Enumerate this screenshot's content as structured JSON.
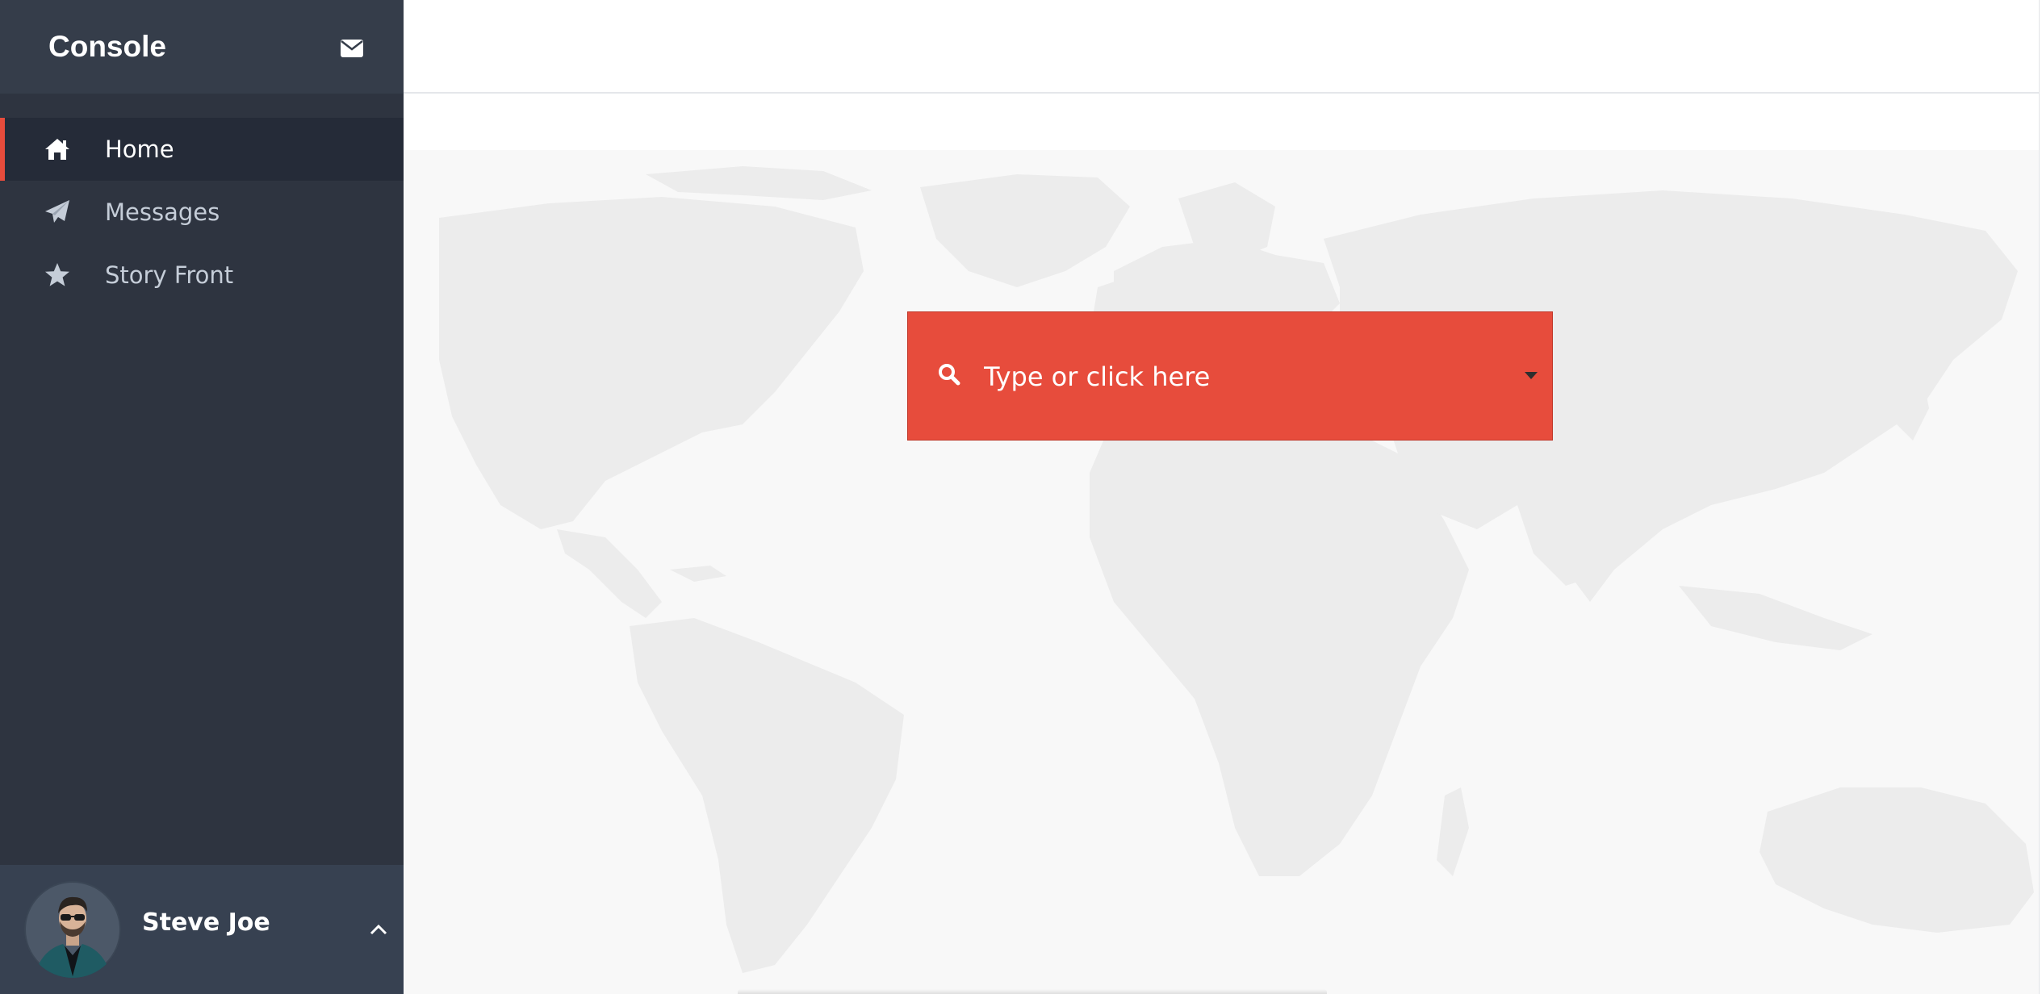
{
  "app": {
    "brand": "Console"
  },
  "sidebar": {
    "header_icon": "envelope-icon",
    "items": [
      {
        "label": "Home",
        "icon": "home-icon",
        "active": true
      },
      {
        "label": "Messages",
        "icon": "paper-plane-icon",
        "active": false
      },
      {
        "label": "Story Front",
        "icon": "star-icon",
        "active": false
      }
    ],
    "user": {
      "name": "Steve Joe",
      "toggle_icon": "chevron-up-icon"
    }
  },
  "search": {
    "placeholder": "Type or click here",
    "icon": "search-icon",
    "dropdown_icon": "caret-down-icon"
  },
  "colors": {
    "sidebar_bg": "#2e3440",
    "sidebar_header_bg": "#353d4a",
    "active_item_bg": "#252b38",
    "accent": "#e74c3c",
    "map_land": "#ececec",
    "main_bg": "#f8f8f8"
  }
}
